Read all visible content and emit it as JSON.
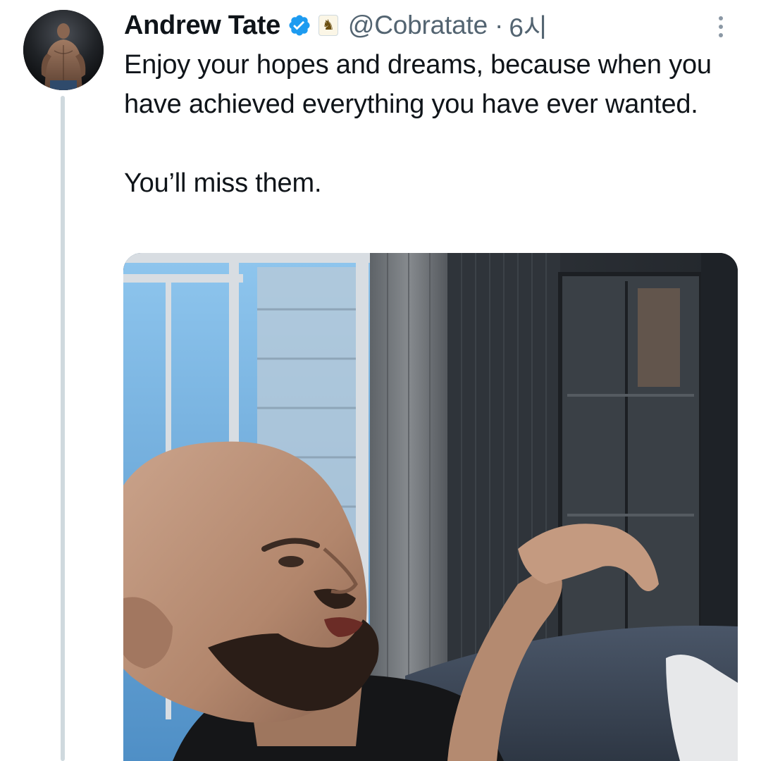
{
  "tweet": {
    "author": {
      "display_name": "Andrew Tate",
      "handle": "@Cobratate",
      "avatar_icon": "profile-photo",
      "verified_icon": "verified-badge-icon",
      "affiliate_icon": "chess-knight-badge-icon",
      "affiliate_glyph": "♞"
    },
    "separator": "·",
    "timestamp": "6시",
    "more_icon": "more-options-icon",
    "text": {
      "line1": "Enjoy your hopes and dreams, because when you have achieved everything you have ever wanted.",
      "line2": "You’ll miss them."
    },
    "media": {
      "type": "video-still"
    }
  },
  "colors": {
    "text_primary": "#0f1419",
    "text_secondary": "#536471",
    "verified_blue": "#1d9bf0",
    "thread_line": "#cfd9de"
  }
}
